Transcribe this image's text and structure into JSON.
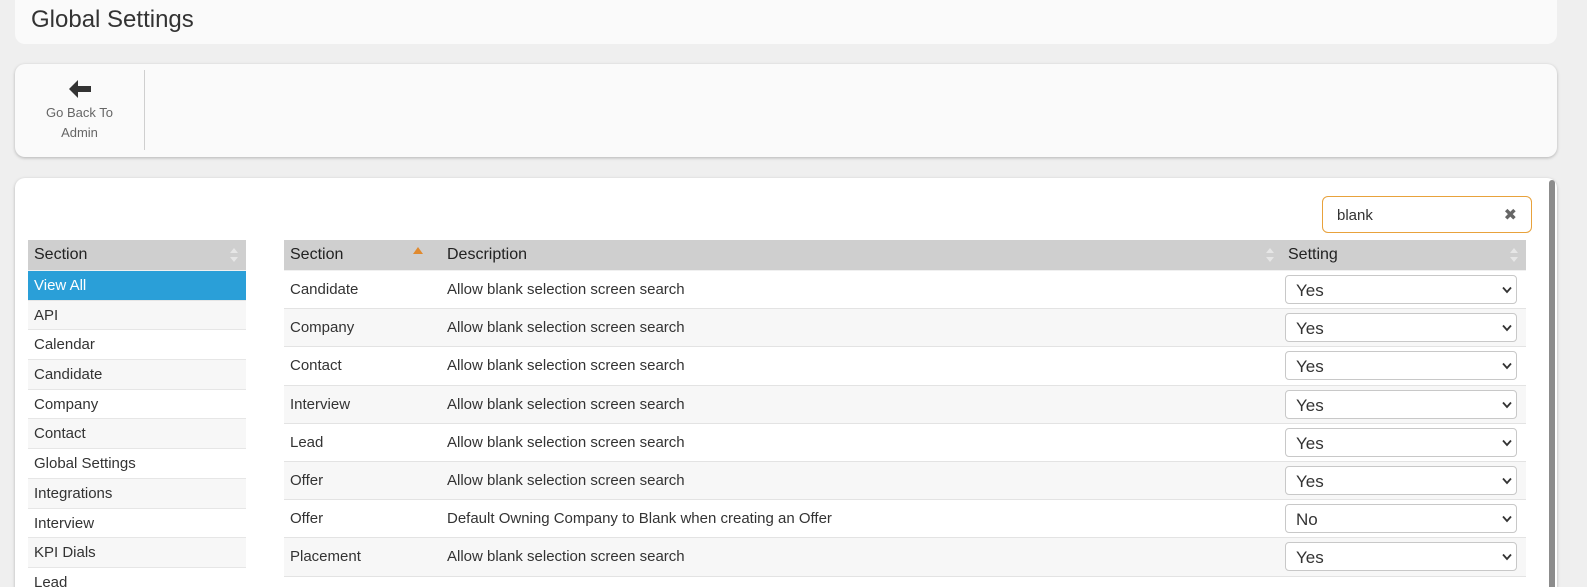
{
  "page": {
    "title": "Global Settings"
  },
  "toolbar": {
    "back_label": "Go Back To Admin",
    "back_icon": "arrow-left-icon"
  },
  "search": {
    "value": "blank",
    "clear_icon": "close-icon",
    "border_color": "#e8a23c"
  },
  "sidebar": {
    "header": "Section",
    "items": [
      {
        "label": "View All",
        "active": true
      },
      {
        "label": "API"
      },
      {
        "label": "Calendar"
      },
      {
        "label": "Candidate"
      },
      {
        "label": "Company"
      },
      {
        "label": "Contact"
      },
      {
        "label": "Global Settings"
      },
      {
        "label": "Integrations"
      },
      {
        "label": "Interview"
      },
      {
        "label": "KPI Dials"
      },
      {
        "label": "Lead"
      }
    ]
  },
  "table": {
    "headers": {
      "section": "Section",
      "description": "Description",
      "setting": "Setting"
    },
    "sorted_by": "section",
    "rows": [
      {
        "section": "Candidate",
        "description": "Allow blank selection screen search",
        "setting": "Yes"
      },
      {
        "section": "Company",
        "description": "Allow blank selection screen search",
        "setting": "Yes"
      },
      {
        "section": "Contact",
        "description": "Allow blank selection screen search",
        "setting": "Yes"
      },
      {
        "section": "Interview",
        "description": "Allow blank selection screen search",
        "setting": "Yes"
      },
      {
        "section": "Lead",
        "description": "Allow blank selection screen search",
        "setting": "Yes"
      },
      {
        "section": "Offer",
        "description": "Allow blank selection screen search",
        "setting": "Yes"
      },
      {
        "section": "Offer",
        "description": "Default Owning Company to Blank when creating an Offer",
        "setting": "No"
      },
      {
        "section": "Placement",
        "description": "Allow blank selection screen search",
        "setting": "Yes"
      }
    ]
  },
  "colors": {
    "active_item": "#2a9fd8",
    "header_bg": "#cfcfcf",
    "sort_arrow": "#e08a2f"
  }
}
